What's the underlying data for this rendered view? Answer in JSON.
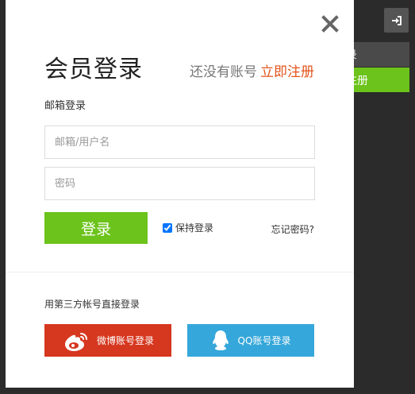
{
  "modal": {
    "title": "会员登录",
    "no_account_text": "还没有账号",
    "register_link": "立即注册",
    "section_label": "邮箱登录",
    "email_placeholder": "邮箱/用户名",
    "password_placeholder": "密码",
    "login_button": "登录",
    "remember_label": "保持登录",
    "remember_checked": true,
    "forgot_link": "忘记密码?",
    "third_party_label": "用第三方帐号直接登录",
    "weibo_button": "微博账号登录",
    "qq_button": "QQ账号登录"
  },
  "background": {
    "login_label": "录",
    "register_label": "注册"
  },
  "colors": {
    "accent_green": "#6cc31b",
    "link_orange": "#e2541b",
    "weibo_red": "#d6371f",
    "qq_blue": "#35a7da",
    "backdrop": "#2b2b2b"
  },
  "icons": {
    "close": "close-icon",
    "sign_in": "sign-in-icon",
    "weibo": "weibo-icon",
    "qq": "qq-icon"
  }
}
